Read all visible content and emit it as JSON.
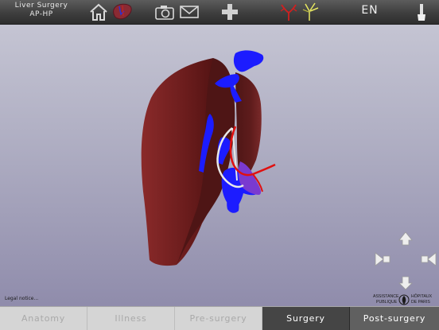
{
  "toolbar": {
    "app_title_line1": "Liver Surgery",
    "app_title_line2": "AP-HP",
    "language": "EN",
    "icons": [
      "home-icon",
      "liver-model-icon",
      "camera-icon",
      "mail-icon",
      "plus-icon",
      "vessels-icon",
      "bile-duct-icon",
      "scalpel-icon"
    ]
  },
  "viewport": {
    "legal_link": "Legal notice...",
    "logo": {
      "line1": "ASSISTANCE",
      "line2": "PUBLIQUE",
      "line3": "HÔPITAUX",
      "line4": "DE PARIS"
    }
  },
  "tabs": [
    {
      "label": "Anatomy",
      "state": "inactive"
    },
    {
      "label": "Illness",
      "state": "inactive"
    },
    {
      "label": "Pre-surgery",
      "state": "inactive"
    },
    {
      "label": "Surgery",
      "state": "active"
    },
    {
      "label": "Post-surgery",
      "state": "current"
    }
  ],
  "colors": {
    "liver": "#6e1c1c",
    "portal_vein": "#1b1bff",
    "artery": "#e01010",
    "bile_duct": "#e8e8e8",
    "toolbar": "#3e3e3e"
  }
}
